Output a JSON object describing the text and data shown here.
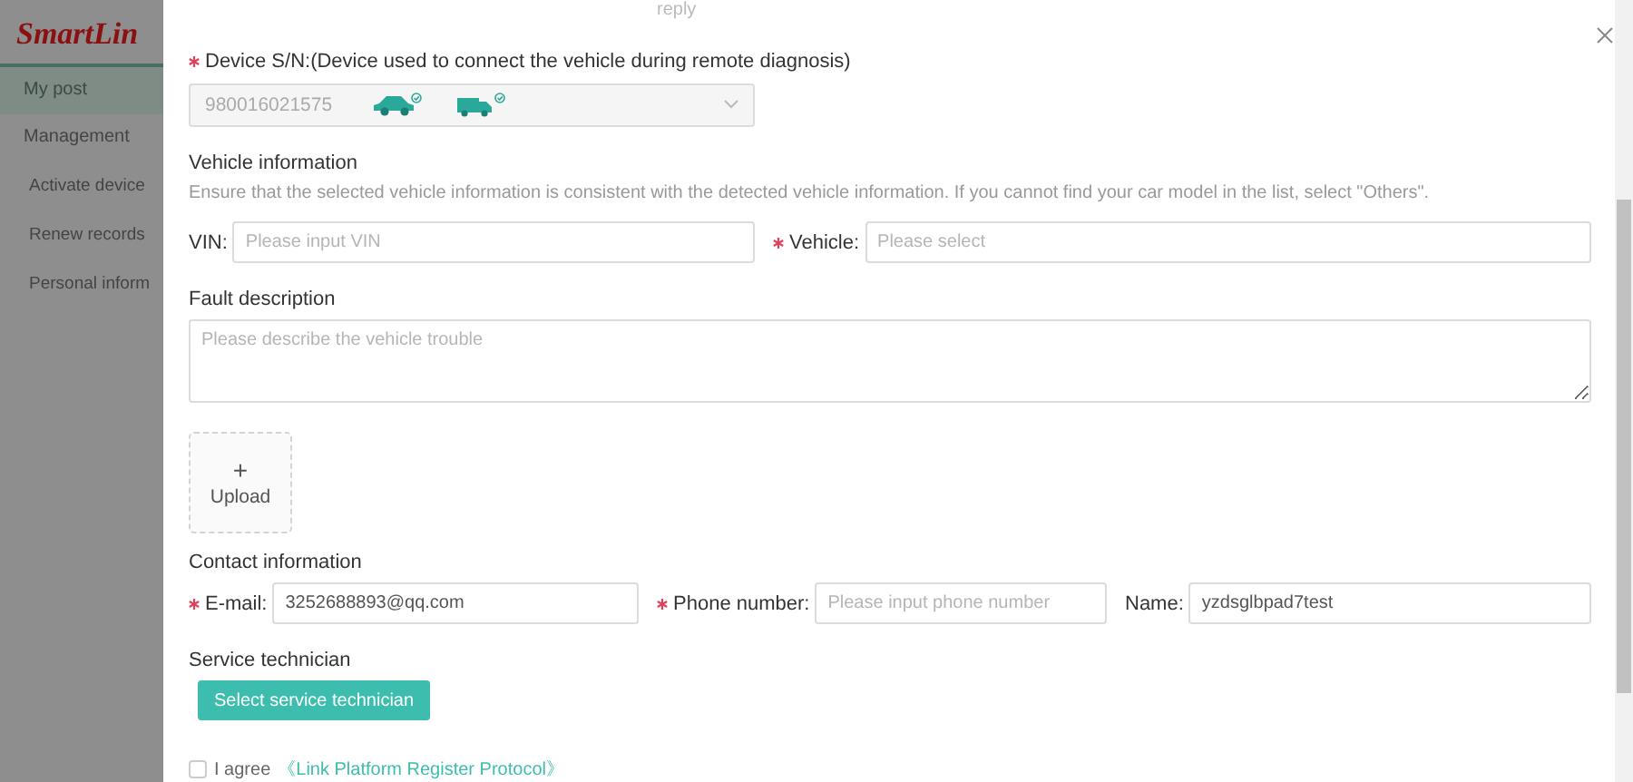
{
  "sidebar": {
    "logo": "SmartLin",
    "items": [
      {
        "label": "My post",
        "selected": true
      },
      {
        "label": "Management",
        "selected": false,
        "children": [
          {
            "label": "Activate device",
            "selected": false
          },
          {
            "label": "Renew records",
            "selected": false
          },
          {
            "label": "Personal inform",
            "selected": false
          }
        ]
      }
    ]
  },
  "dialog": {
    "top_text": "reply",
    "device": {
      "label": "Device S/N:(Device used to connect the vehicle during remote diagnosis)",
      "required": true,
      "value": "980016021575",
      "disabled": true
    },
    "vehicle_section": {
      "heading": "Vehicle information",
      "hint": "Ensure that the selected vehicle information is consistent with the detected vehicle information. If you cannot find your car model in the list, select \"Others\".",
      "fields": [
        {
          "label": "VIN:",
          "required": false,
          "placeholder": "Please input VIN"
        },
        {
          "label": "Vehicle:",
          "required": true,
          "placeholder": "Please select"
        }
      ]
    },
    "fault": {
      "heading": "Fault description",
      "placeholder": "Please describe the vehicle trouble"
    },
    "upload": {
      "symbol": "+",
      "label": "Upload"
    },
    "contact": {
      "heading": "Contact information",
      "fields": [
        {
          "label": "E-mail:",
          "required": true,
          "value": "3252688893@qq.com"
        },
        {
          "label": "Phone number:",
          "required": true,
          "placeholder": "Please input phone number"
        },
        {
          "label": "Name:",
          "required": false,
          "value": "yzdsglbpad7test"
        }
      ]
    },
    "technician": {
      "heading": "Service technician",
      "button": "Select service technician"
    },
    "agreement": {
      "checked": false,
      "text": "I agree",
      "link": "《Link Platform Register Protocol》"
    }
  }
}
